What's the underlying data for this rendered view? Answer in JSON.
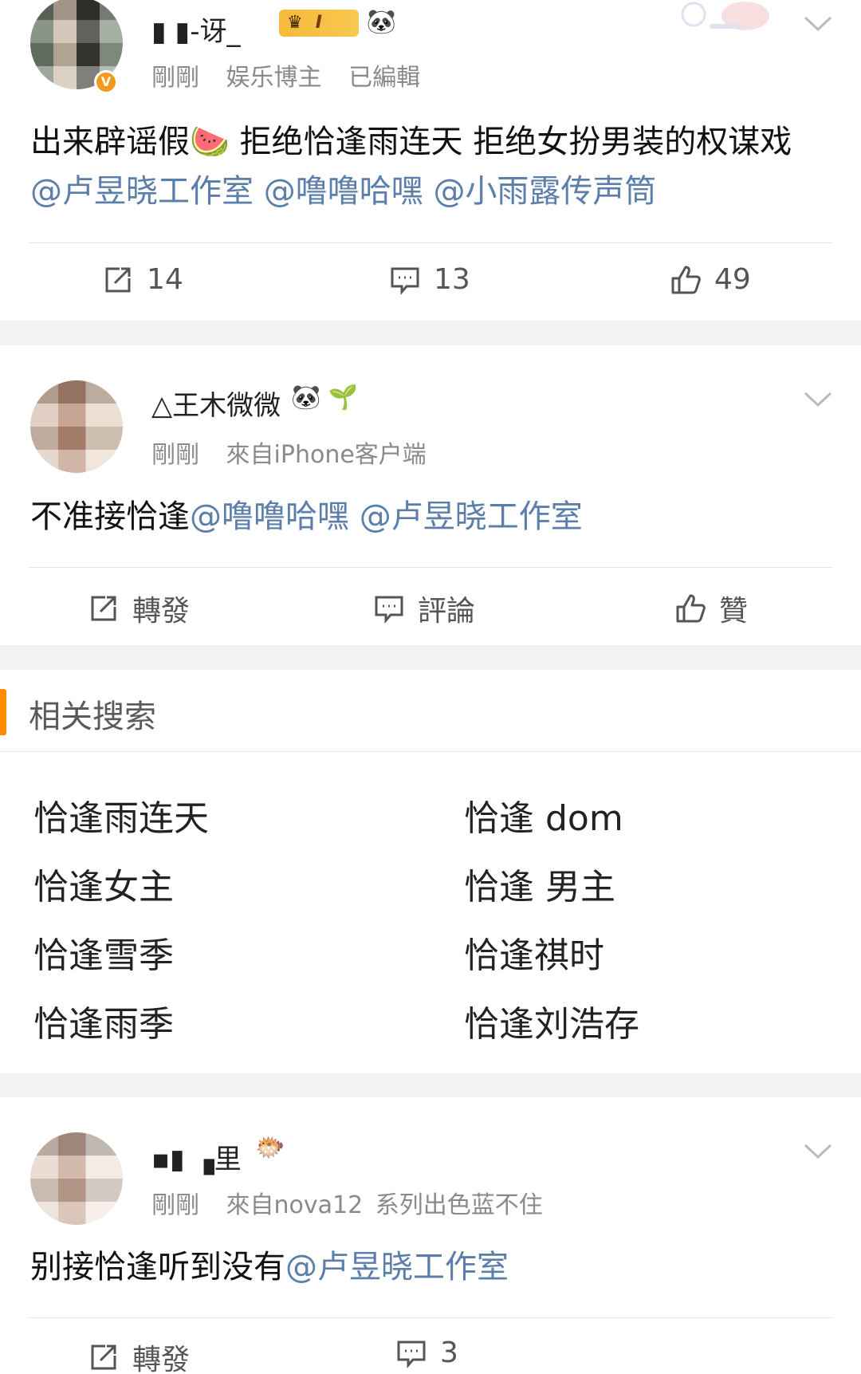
{
  "posts": [
    {
      "username": "▮ ▮-讶_",
      "badges": "🐼",
      "level_badge": "I",
      "meta": [
        "剛剛",
        "娱乐博主",
        "已編輯"
      ],
      "content_text": "出来辟谣假🍉 拒绝恰逢雨连天 拒绝女扮男装的权谋戏 ",
      "mentions": [
        "@卢昱晓工作室",
        "@噜噜哈嘿",
        "@小雨露传声筒"
      ],
      "actions": {
        "repost": "14",
        "comment": "13",
        "like": "49"
      }
    },
    {
      "username": "△王木微微",
      "badges": "🐼 🌱",
      "meta": [
        "剛剛",
        "來自iPhone客户端"
      ],
      "content_text": "不准接恰逢",
      "mentions": [
        "@噜噜哈嘿",
        "@卢昱晓工作室"
      ],
      "actions": {
        "repost": "轉發",
        "comment": "評論",
        "like": "贊"
      }
    },
    {
      "username": "▪▮ ▗里",
      "badges": "🐡",
      "meta": [
        "剛剛",
        "來自nova12 系列出色蓝不住"
      ],
      "content_text": "别接恰逢听到没有",
      "mentions": [
        "@卢昱晓工作室"
      ],
      "actions": {
        "repost": "轉發",
        "comment": "3"
      }
    }
  ],
  "related": {
    "title": "相关搜索",
    "left": [
      "恰逢雨连天",
      "恰逢女主",
      "恰逢雪季",
      "恰逢雨季"
    ],
    "right": [
      "恰逢 dom",
      "恰逢 男主",
      "恰逢祺时",
      "恰逢刘浩存"
    ]
  },
  "colors": {
    "accent": "#ff8a00",
    "mention": "#5b7eab",
    "meta": "#8a8a8a",
    "verified": "#f39a1d"
  },
  "icons": [
    "repost-icon",
    "comment-icon",
    "like-icon",
    "chevron-down-icon",
    "verified-icon"
  ]
}
